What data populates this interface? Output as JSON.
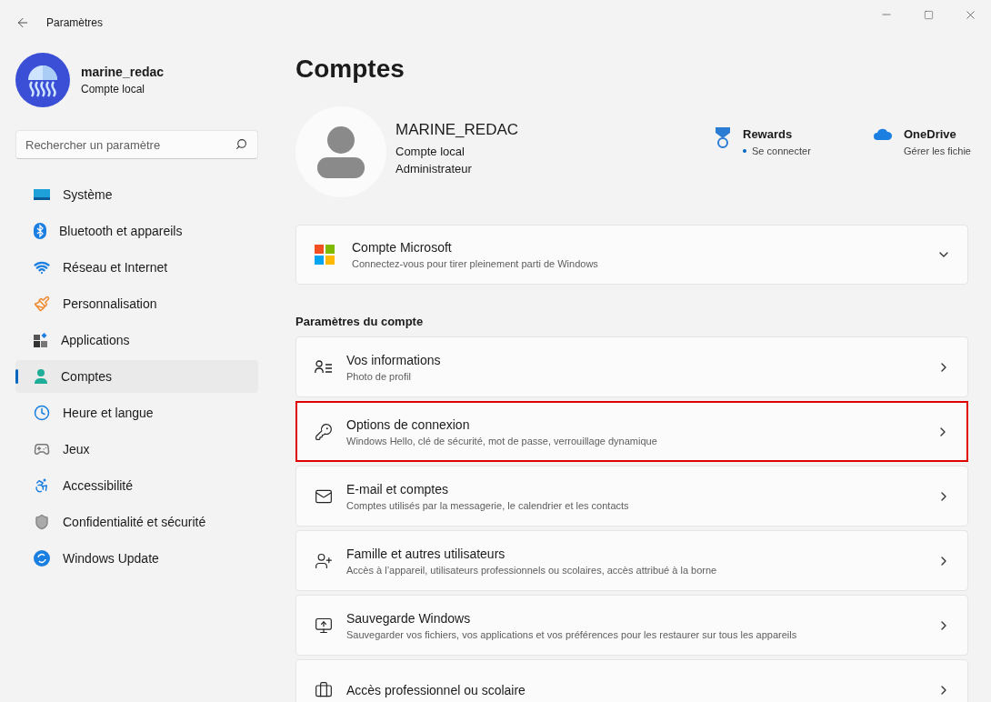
{
  "window": {
    "title": "Paramètres"
  },
  "user": {
    "name": "marine_redac",
    "type": "Compte local"
  },
  "search": {
    "placeholder": "Rechercher un paramètre"
  },
  "sidebar": {
    "items": [
      {
        "label": "Système",
        "selected": false
      },
      {
        "label": "Bluetooth et appareils",
        "selected": false
      },
      {
        "label": "Réseau et Internet",
        "selected": false
      },
      {
        "label": "Personnalisation",
        "selected": false
      },
      {
        "label": "Applications",
        "selected": false
      },
      {
        "label": "Comptes",
        "selected": true
      },
      {
        "label": "Heure et langue",
        "selected": false
      },
      {
        "label": "Jeux",
        "selected": false
      },
      {
        "label": "Accessibilité",
        "selected": false
      },
      {
        "label": "Confidentialité et sécurité",
        "selected": false
      },
      {
        "label": "Windows Update",
        "selected": false
      }
    ]
  },
  "page": {
    "title": "Comptes",
    "profile": {
      "name": "MARINE_REDAC",
      "lines": [
        "Compte local",
        "Administrateur"
      ]
    },
    "services": [
      {
        "title": "Rewards",
        "subtitle": "Se connecter",
        "dot": true
      },
      {
        "title": "OneDrive",
        "subtitle": "Gérer les fichie",
        "dot": false
      }
    ],
    "microsoft_card": {
      "title": "Compte Microsoft",
      "subtitle": "Connectez-vous pour tirer pleinement parti de Windows",
      "expanded": false
    },
    "section_title": "Paramètres du compte",
    "cards": [
      {
        "title": "Vos informations",
        "subtitle": "Photo de profil",
        "highlighted": false
      },
      {
        "title": "Options de connexion",
        "subtitle": "Windows Hello, clé de sécurité, mot de passe, verrouillage dynamique",
        "highlighted": true
      },
      {
        "title": "E-mail et comptes",
        "subtitle": "Comptes utilisés par la messagerie, le calendrier et les contacts",
        "highlighted": false
      },
      {
        "title": "Famille et autres utilisateurs",
        "subtitle": "Accès à l’appareil, utilisateurs professionnels ou scolaires, accès attribué à la borne",
        "highlighted": false
      },
      {
        "title": "Sauvegarde Windows",
        "subtitle": "Sauvegarder vos fichiers, vos applications et vos préférences pour les restaurer sur tous les appareils",
        "highlighted": false
      },
      {
        "title": "Accès professionnel ou scolaire",
        "highlighted": false
      }
    ]
  }
}
